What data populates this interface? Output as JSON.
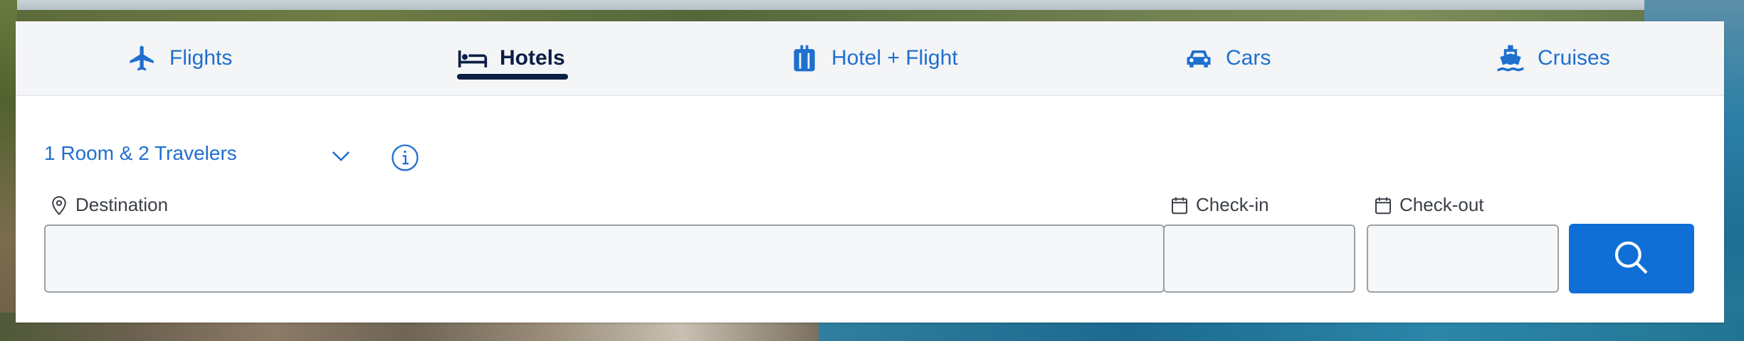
{
  "tabs": [
    {
      "label": "Flights",
      "icon": "airplane-icon"
    },
    {
      "label": "Hotels",
      "icon": "bed-icon"
    },
    {
      "label": "Hotel + Flight",
      "icon": "luggage-icon"
    },
    {
      "label": "Cars",
      "icon": "car-icon"
    },
    {
      "label": "Cruises",
      "icon": "ship-icon"
    }
  ],
  "active_tab": "Hotels",
  "form": {
    "rooms_selector": "1 Room & 2 Travelers",
    "destination_label": "Destination",
    "destination_value": "",
    "checkin_label": "Check-in",
    "checkin_value": "",
    "checkout_label": "Check-out",
    "checkout_value": ""
  },
  "colors": {
    "accent": "#1f6fcf",
    "active_tab": "#0b1f45",
    "search_button": "#0f6fd6",
    "tab_bar_bg": "#f4f5f7"
  }
}
